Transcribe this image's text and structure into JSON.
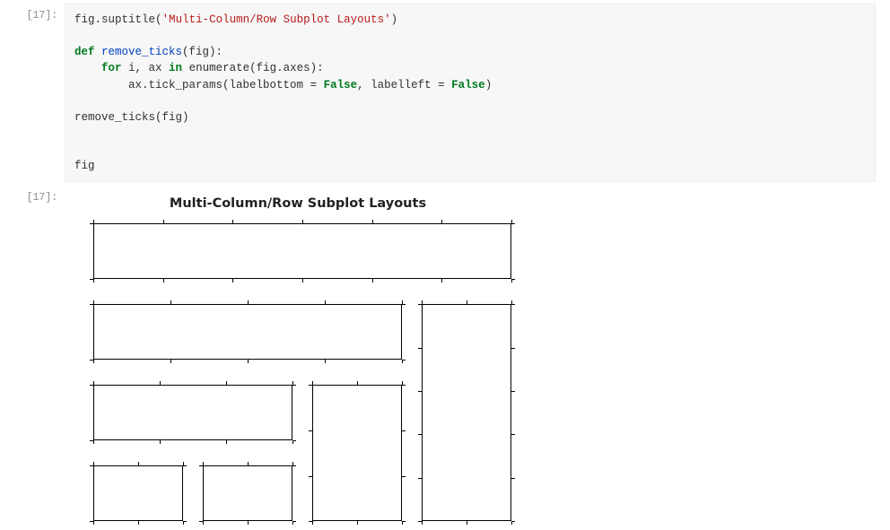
{
  "input_prompt": "[17]:",
  "output_prompt": "[17]:",
  "code_tokens": [
    {
      "t": "fig",
      "c": "n"
    },
    {
      "t": ".",
      "c": "p"
    },
    {
      "t": "suptitle",
      "c": "n"
    },
    {
      "t": "(",
      "c": "p"
    },
    {
      "t": "'Multi-Column/Row Subplot Layouts'",
      "c": "s"
    },
    {
      "t": ")",
      "c": "p"
    },
    {
      "t": "\n\n",
      "c": ""
    },
    {
      "t": "def",
      "c": "k"
    },
    {
      "t": " ",
      "c": ""
    },
    {
      "t": "remove_ticks",
      "c": "nf"
    },
    {
      "t": "(fig):",
      "c": "p"
    },
    {
      "t": "\n    ",
      "c": ""
    },
    {
      "t": "for",
      "c": "k"
    },
    {
      "t": " i, ax ",
      "c": "n"
    },
    {
      "t": "in",
      "c": "k"
    },
    {
      "t": " ",
      "c": ""
    },
    {
      "t": "enumerate",
      "c": "n"
    },
    {
      "t": "(fig",
      "c": "p"
    },
    {
      "t": ".",
      "c": "p"
    },
    {
      "t": "axes",
      "c": "n"
    },
    {
      "t": "):",
      "c": "p"
    },
    {
      "t": "\n        ax",
      "c": "n"
    },
    {
      "t": ".",
      "c": "p"
    },
    {
      "t": "tick_params",
      "c": "n"
    },
    {
      "t": "(labelbottom ",
      "c": "p"
    },
    {
      "t": "=",
      "c": "p"
    },
    {
      "t": " ",
      "c": ""
    },
    {
      "t": "False",
      "c": "kc"
    },
    {
      "t": ", labelleft ",
      "c": "p"
    },
    {
      "t": "=",
      "c": "p"
    },
    {
      "t": " ",
      "c": ""
    },
    {
      "t": "False",
      "c": "kc"
    },
    {
      "t": ")",
      "c": "p"
    },
    {
      "t": "\n\nremove_ticks(fig)\n\n\nfig",
      "c": "n"
    }
  ],
  "chart_data": {
    "type": "subplot-layout",
    "suptitle": "Multi-Column/Row Subplot Layouts",
    "grid": {
      "rows": 4,
      "cols": 4
    },
    "panels": [
      {
        "name": "ax0",
        "row": 0,
        "col": 0,
        "rowspan": 1,
        "colspan": 4
      },
      {
        "name": "ax1",
        "row": 1,
        "col": 0,
        "rowspan": 1,
        "colspan": 3
      },
      {
        "name": "ax2",
        "row": 2,
        "col": 0,
        "rowspan": 1,
        "colspan": 2
      },
      {
        "name": "ax3",
        "row": 3,
        "col": 0,
        "rowspan": 1,
        "colspan": 1
      },
      {
        "name": "ax4",
        "row": 3,
        "col": 1,
        "rowspan": 1,
        "colspan": 1
      },
      {
        "name": "ax5",
        "row": 2,
        "col": 2,
        "rowspan": 2,
        "colspan": 1
      },
      {
        "name": "ax6",
        "row": 1,
        "col": 3,
        "rowspan": 3,
        "colspan": 1
      }
    ],
    "axis_labels_visible": false,
    "tick_labels_visible": false
  }
}
